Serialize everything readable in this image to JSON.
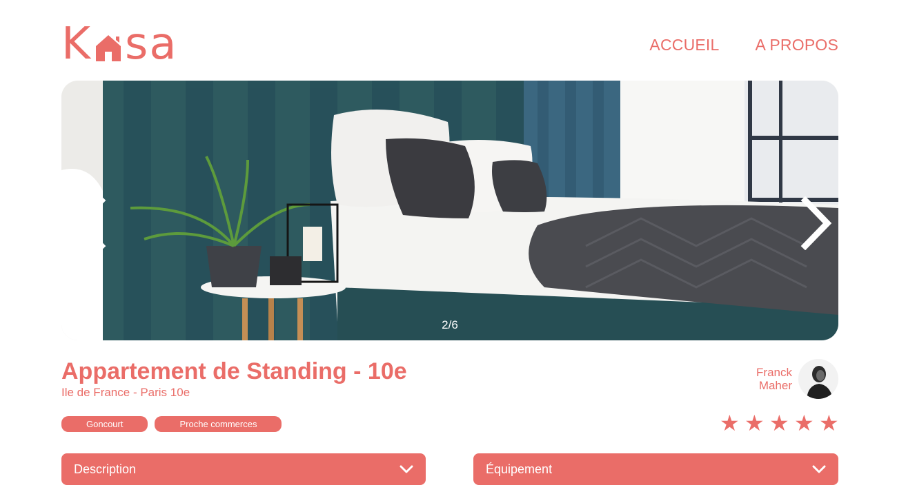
{
  "header": {
    "logo": {
      "letters_left": "K",
      "letters_right": "sa",
      "icon": "house-icon"
    },
    "nav": [
      {
        "label": "ACCUEIL"
      },
      {
        "label": "A PROPOS"
      }
    ]
  },
  "carousel": {
    "counter": "2/6",
    "prev_icon": "chevron-left-icon",
    "next_icon": "chevron-right-icon"
  },
  "listing": {
    "title": "Appartement de Standing - 10e",
    "location": "Ile de France - Paris 10e",
    "tags": [
      "Goncourt",
      "Proche commerces"
    ],
    "rating": {
      "value": 5,
      "max": 5
    }
  },
  "host": {
    "first_name": "Franck",
    "last_name": "Maher"
  },
  "collapses": [
    {
      "label": "Description",
      "icon": "chevron-down-icon"
    },
    {
      "label": "Équipement",
      "icon": "chevron-down-icon"
    }
  ],
  "colors": {
    "accent": "#ea6d68",
    "white": "#ffffff"
  }
}
